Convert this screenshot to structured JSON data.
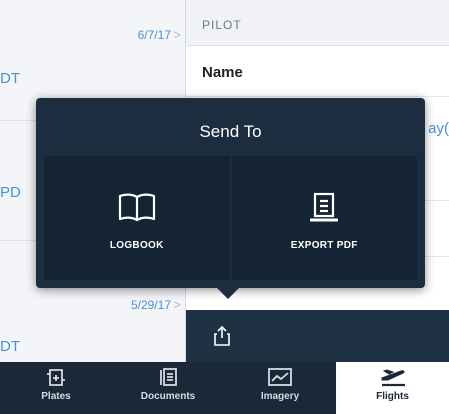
{
  "list": {
    "rows": [
      {
        "date": "6/7/17",
        "edge": "DT"
      },
      {
        "edge": "PD"
      },
      {
        "date": "5/29/17",
        "edge": "DT"
      }
    ]
  },
  "detail": {
    "section": "PILOT",
    "field": "Name",
    "clipped_value": "ay("
  },
  "popover": {
    "title": "Send To",
    "options": [
      {
        "label": "LOGBOOK",
        "icon": "book-icon"
      },
      {
        "label": "EXPORT PDF",
        "icon": "document-icon"
      }
    ]
  },
  "share": {
    "icon": "share-icon"
  },
  "tabs": [
    {
      "label": "Plates",
      "icon": "plates-icon",
      "active": false
    },
    {
      "label": "Documents",
      "icon": "documents-icon",
      "active": false
    },
    {
      "label": "Imagery",
      "icon": "imagery-icon",
      "active": false
    },
    {
      "label": "Flights",
      "icon": "airplane-icon",
      "active": true
    }
  ],
  "colors": {
    "popover_bg": "#1b2d3f",
    "tile_bg": "#142434",
    "tabbar_bg": "#1a2838",
    "accent": "#4a90d9"
  }
}
